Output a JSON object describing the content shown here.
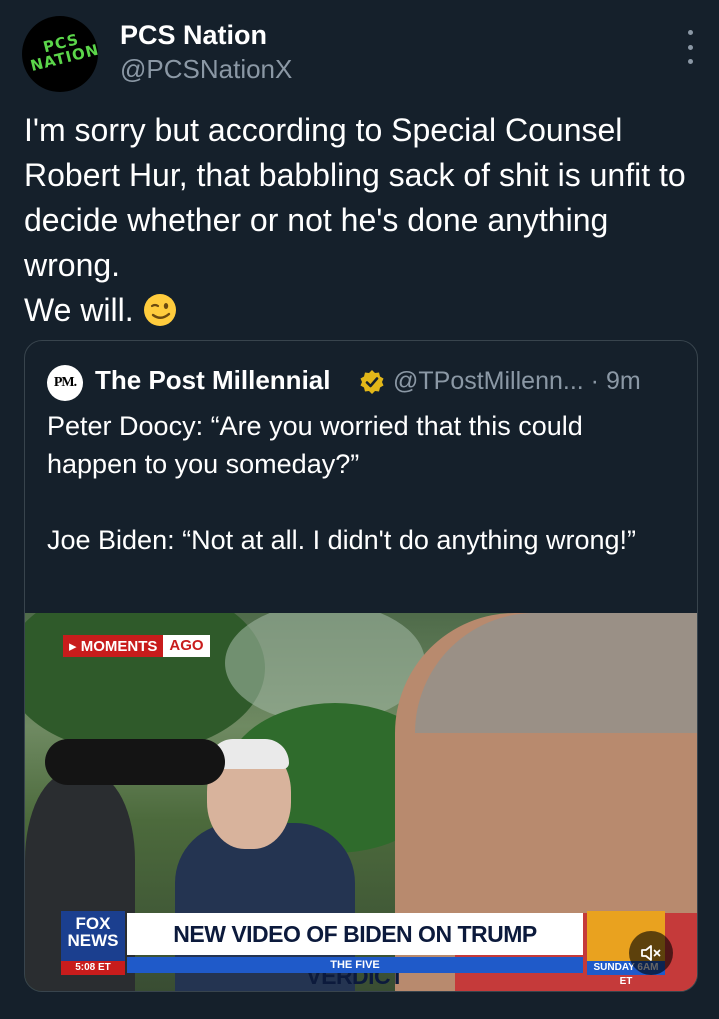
{
  "author": {
    "logo_text": "PCS NATION",
    "name": "PCS Nation",
    "handle": "@PCSNationX"
  },
  "tweet": {
    "text": "I'm sorry but according to Special Counsel Robert Hur, that babbling sack of shit is unfit to decide whether or not he's done anything wrong.\nWe will.",
    "emoji": "winking-face"
  },
  "quoted": {
    "avatar_text": "PM.",
    "name": "The Post Millennial",
    "handle": "@TPostMillenn...",
    "time": "· 9m",
    "paragraphs": [
      "Peter Doocy: “Are you worried that this could happen to you someday?”",
      "Joe Biden: “Not at all. I didn't do anything wrong!”"
    ]
  },
  "video": {
    "moments_a": "▸ MOMENTS",
    "moments_b": "AGO",
    "network": "FOX NEWS",
    "clock": "5:08 ET",
    "headline": "NEW VIDEO OF BIDEN ON TRUMP VERDICT",
    "show": "THE FIVE",
    "promo": "SUNDAY 6AM ET",
    "mute_icon": "speaker-muted-icon"
  },
  "colors": {
    "background": "#15202b",
    "text": "#e7e9ea",
    "secondary": "#8b98a5",
    "border": "#38444d",
    "verified_gold": "#e2b719"
  }
}
